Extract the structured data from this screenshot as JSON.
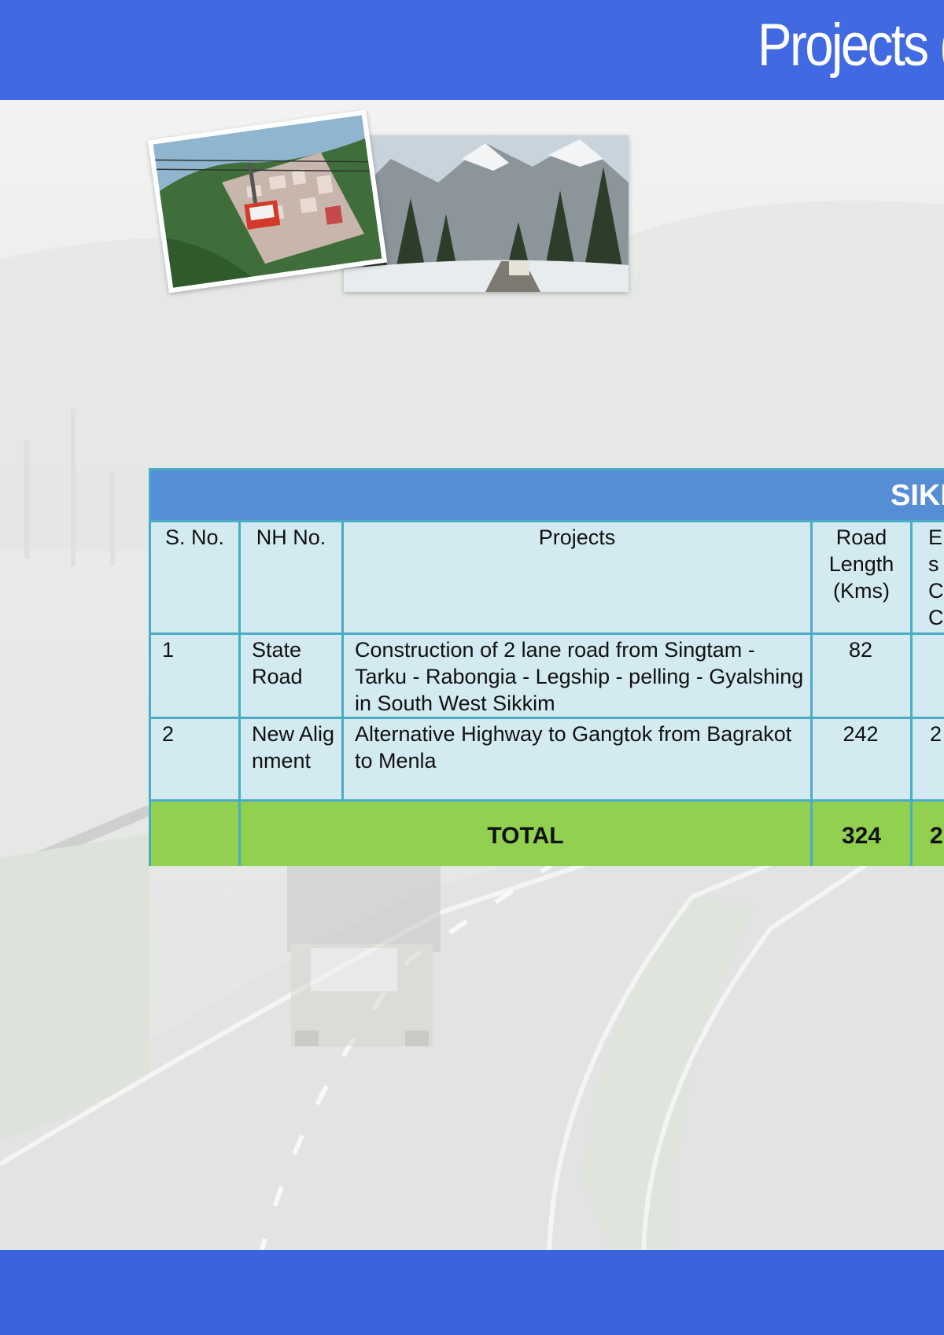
{
  "header": {
    "title": "Projects ("
  },
  "photos": {
    "left": {
      "icon": "cable-car-town-photo"
    },
    "right": {
      "icon": "snowy-forest-road-photo"
    }
  },
  "table": {
    "title": "SIKK",
    "headers": {
      "sno": "S. No.",
      "nh": "NH No.",
      "projects": "Projects",
      "length": "Road Length (Kms)",
      "cost": "Es C C"
    },
    "rows": [
      {
        "sno": "1",
        "nh": "State Road",
        "project": "Construction of 2 lane road from Singtam - Tarku - Rabongia - Legship - pelling - Gyalshing in South West Sikkim",
        "length": "82",
        "cost": ""
      },
      {
        "sno": "2",
        "nh": "New Alignment",
        "project": "Alternative Highway to Gangtok from Bagrakot to Menla",
        "length": "242",
        "cost": "2"
      }
    ],
    "total": {
      "label": "TOTAL",
      "length": "324",
      "cost": "2"
    }
  },
  "colors": {
    "header_bar": "#4169e1",
    "footer_bar": "#3b63dc",
    "table_title": "#558ed5",
    "table_cell": "#d2eaf0",
    "table_border": "#4bacc6",
    "total_row": "#92d050"
  }
}
